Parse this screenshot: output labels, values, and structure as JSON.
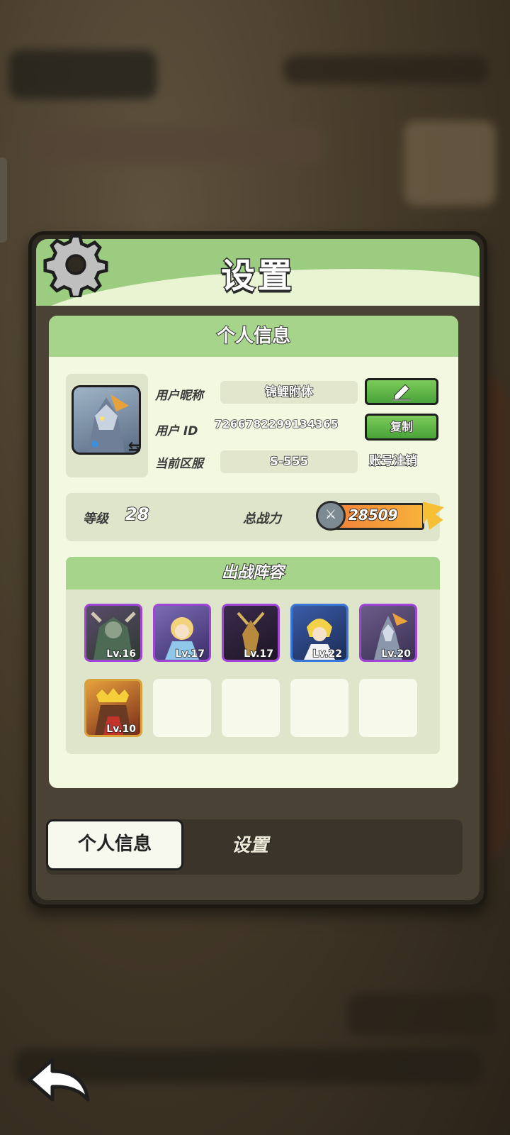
{
  "dialog": {
    "title": "设置",
    "card_title": "个人信息",
    "profile": {
      "nickname_label": "用户昵称",
      "nickname": "锦鲤附体",
      "id_label": "用户  ID",
      "user_id": "7266782299134365",
      "server_label": "当前区服",
      "server": "S-555",
      "copy_label": "复制",
      "cancel_account_label": "账号注销"
    },
    "stats": {
      "level_label": "等级",
      "level": "28",
      "power_label": "总战力",
      "power": "28509"
    },
    "lineup": {
      "title": "出战阵容",
      "heroes": [
        {
          "level": "Lv.16",
          "rarity_color": "#9f45d6"
        },
        {
          "level": "Lv.17",
          "rarity_color": "#9f45d6"
        },
        {
          "level": "Lv.17",
          "rarity_color": "#9f45d6"
        },
        {
          "level": "Lv.22",
          "rarity_color": "#3a76d8"
        },
        {
          "level": "Lv.20",
          "rarity_color": "#9f45d6"
        },
        {
          "level": "Lv.10",
          "rarity_color": "#d9a23a"
        }
      ]
    },
    "tabs": [
      {
        "label": "个人信息",
        "active": true
      },
      {
        "label": "设置",
        "active": false
      }
    ]
  },
  "icons": {
    "settings": "gear-icon",
    "edit": "pencil-icon",
    "swap": "swap-arrows-icon",
    "power": "crossed-swords-icon",
    "back": "back-arrow-icon"
  }
}
